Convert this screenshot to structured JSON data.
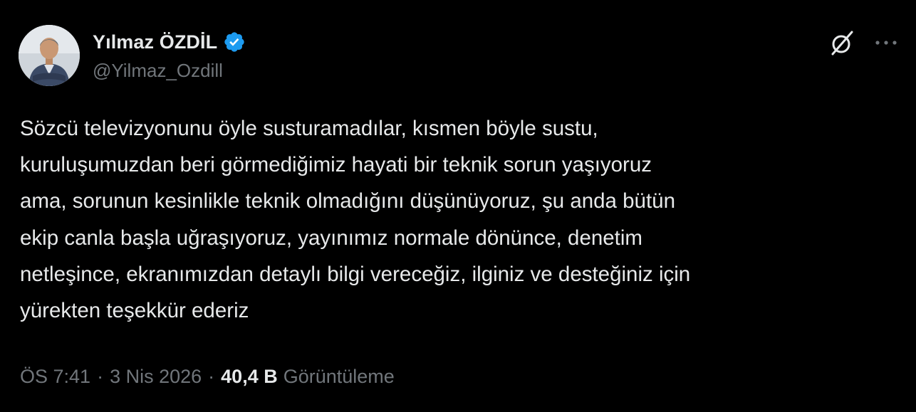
{
  "author": {
    "display_name": "Yılmaz ÖZDİL",
    "handle": "@Yilmaz_Ozdill",
    "verified": true,
    "avatar_icon": "profile-photo"
  },
  "header_actions": {
    "grok_icon": "grok-icon",
    "more_icon": "more-horizontal-icon"
  },
  "tweet": {
    "text": "Sözcü televizyonunu öyle susturamadılar, kısmen böyle sustu,\nkuruluşumuzdan beri görmediğimiz hayati bir teknik sorun yaşıyoruz\nama, sorunun kesinlikle teknik olmadığını düşünüyoruz, şu anda bütün\nekip canla başla uğraşıyoruz, yayınımız normale dönünce, denetim\nnetleşince, ekranımızdan detaylı bilgi vereceğiz, ilginiz ve desteğiniz için\nyürekten teşekkür ederiz"
  },
  "meta": {
    "time": "ÖS 7:41",
    "separator": "·",
    "date": "3 Nis 2026",
    "views_count": "40,4 B",
    "views_label": "Görüntüleme"
  },
  "colors": {
    "background": "#000000",
    "text_primary": "#e7e9ea",
    "text_secondary": "#71767b",
    "verified_badge": "#1d9bf0"
  }
}
